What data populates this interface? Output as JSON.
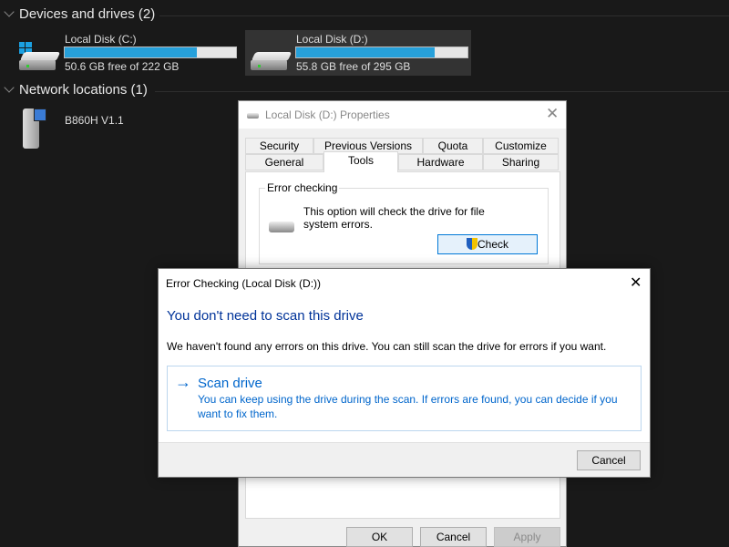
{
  "explorer": {
    "devices_header": "Devices and drives (2)",
    "network_header": "Network locations (1)",
    "drives": [
      {
        "name": "Local Disk (C:)",
        "free": "50.6 GB free of 222 GB",
        "used_fraction": 0.772
      },
      {
        "name": "Local Disk (D:)",
        "free": "55.8 GB free of 295 GB",
        "used_fraction": 0.811
      }
    ],
    "network": [
      {
        "name": "B860H V1.1"
      }
    ]
  },
  "properties": {
    "title": "Local Disk (D:) Properties",
    "tabs_row1": [
      "Security",
      "Previous Versions",
      "Quota",
      "Customize"
    ],
    "tabs_row2": [
      "General",
      "Tools",
      "Hardware",
      "Sharing"
    ],
    "active_tab": "Tools",
    "group_label": "Error checking",
    "description": "This option will check the drive for file system errors.",
    "check_button": "Check",
    "ok": "OK",
    "cancel": "Cancel",
    "apply": "Apply"
  },
  "error_dialog": {
    "title": "Error Checking (Local Disk (D:))",
    "heading": "You don't need to scan this drive",
    "message": "We haven't found any errors on this drive. You can still scan the drive for errors if you want.",
    "scan_title": "Scan drive",
    "scan_desc": "You can keep using the drive during the scan. If errors are found, you can decide if you want to fix them.",
    "cancel": "Cancel",
    "accent": "#0066cc"
  }
}
